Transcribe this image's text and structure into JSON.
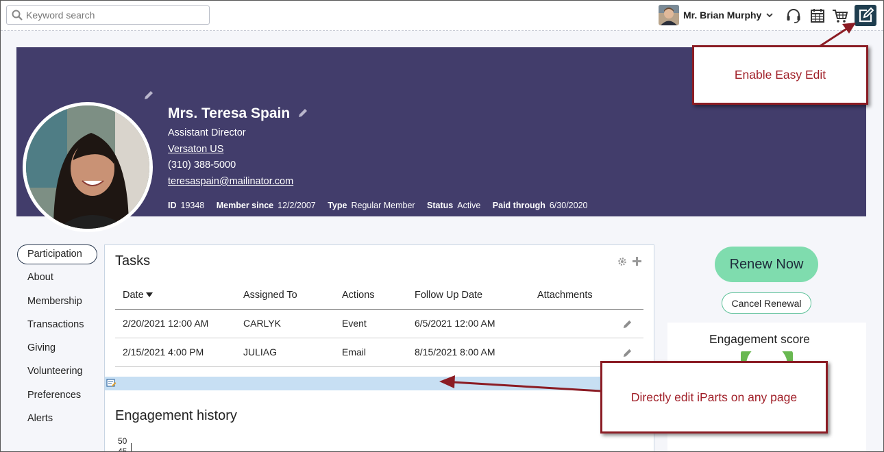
{
  "topbar": {
    "search_placeholder": "Keyword search",
    "user_name": "Mr. Brian Murphy",
    "icons": [
      "search-icon",
      "chevron-down-icon",
      "headset-icon",
      "calendar-icon",
      "cart-icon",
      "edit-square-icon"
    ]
  },
  "profile": {
    "name": "Mrs. Teresa Spain",
    "title": "Assistant Director",
    "company": "Versaton US",
    "phone": "(310) 388-5000",
    "email": "teresaspain@mailinator.com",
    "meta": {
      "id_label": "ID",
      "id_value": "19348",
      "member_since_label": "Member since",
      "member_since_value": "12/2/2007",
      "type_label": "Type",
      "type_value": "Regular Member",
      "status_label": "Status",
      "status_value": "Active",
      "paid_through_label": "Paid through",
      "paid_through_value": "6/30/2020"
    }
  },
  "nav": {
    "items": [
      "Participation",
      "About",
      "Membership",
      "Transactions",
      "Giving",
      "Volunteering",
      "Preferences",
      "Alerts"
    ],
    "active": "Participation"
  },
  "tasks": {
    "title": "Tasks",
    "columns": [
      "Date",
      "Assigned To",
      "Actions",
      "Follow Up Date",
      "Attachments"
    ],
    "rows": [
      [
        "2/20/2021 12:00 AM",
        "CARLYK",
        "Event",
        "6/5/2021 12:00 AM",
        ""
      ],
      [
        "2/15/2021 4:00 PM",
        "JULIAG",
        "Email",
        "8/15/2021 8:00 AM",
        ""
      ]
    ]
  },
  "engagement_history": {
    "title": "Engagement history",
    "y_ticks": [
      "50",
      "45"
    ]
  },
  "right": {
    "renew_label": "Renew Now",
    "cancel_label": "Cancel Renewal",
    "engagement_score_title": "Engagement score"
  },
  "callouts": {
    "easy_edit": "Enable Easy Edit",
    "iparts": "Directly edit iParts on any page"
  },
  "colors": {
    "banner": "#423d6b",
    "renew": "#7fdcae",
    "callout_border": "#8b1c24",
    "edit_strip": "#c7dff3",
    "easy_edit_button": "#1f3e4f"
  }
}
